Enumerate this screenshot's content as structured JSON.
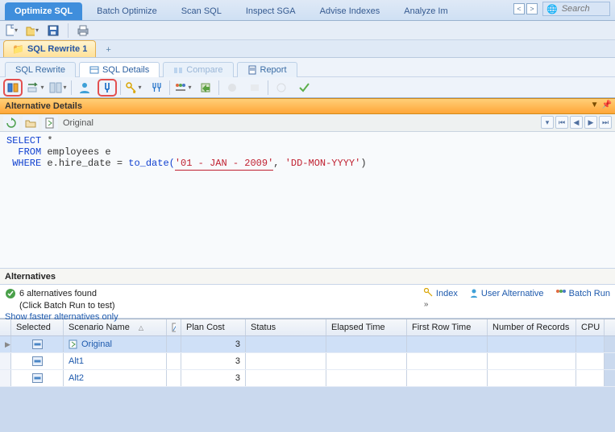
{
  "top_tabs": {
    "optimize_sql": "Optimize SQL",
    "batch_optimize": "Batch Optimize",
    "scan_sql": "Scan SQL",
    "inspect_sga": "Inspect SGA",
    "advise_indexes": "Advise Indexes",
    "analyze_impact": "Analyze Im"
  },
  "search": {
    "placeholder": "Search"
  },
  "doc_tabs": {
    "sql_rewrite_1": "SQL Rewrite 1",
    "add": "+"
  },
  "sub_tabs": {
    "sql_rewrite": "SQL Rewrite",
    "sql_details": "SQL Details",
    "compare": "Compare",
    "report": "Report"
  },
  "alt_details_header": "Alternative Details",
  "original_label": "Original",
  "sql": {
    "select": "SELECT",
    "star": " *",
    "from": "FROM",
    "table": " employees e",
    "where": "WHERE",
    "col": " e.hire_date = ",
    "func": "to_date(",
    "arg1": "'01 - JAN - 2009'",
    "comma": ", ",
    "arg2": "'DD-MON-YYYY'",
    "close": ")"
  },
  "alternatives_header": "Alternatives",
  "alt_info": {
    "found": "6 alternatives found",
    "hint": "(Click Batch Run to test)",
    "show_faster": "Show faster alternatives only",
    "index": "Index",
    "user_alt": "User Alternative",
    "batch_run": "Batch Run",
    "chev": "»"
  },
  "grid": {
    "headers": {
      "selected": "Selected",
      "scenario": "Scenario Name",
      "plan": "Plan Cost",
      "status": "Status",
      "elapsed": "Elapsed Time",
      "first_row": "First Row Time",
      "records": "Number of Records",
      "cpu": "CPU"
    },
    "rows": [
      {
        "name": "Original",
        "plan_cost": "3",
        "selected": true,
        "highlight": true,
        "icon": true
      },
      {
        "name": "Alt1",
        "plan_cost": "3",
        "selected": false,
        "highlight": false,
        "icon": false
      },
      {
        "name": "Alt2",
        "plan_cost": "3",
        "selected": false,
        "highlight": false,
        "icon": false
      }
    ]
  }
}
